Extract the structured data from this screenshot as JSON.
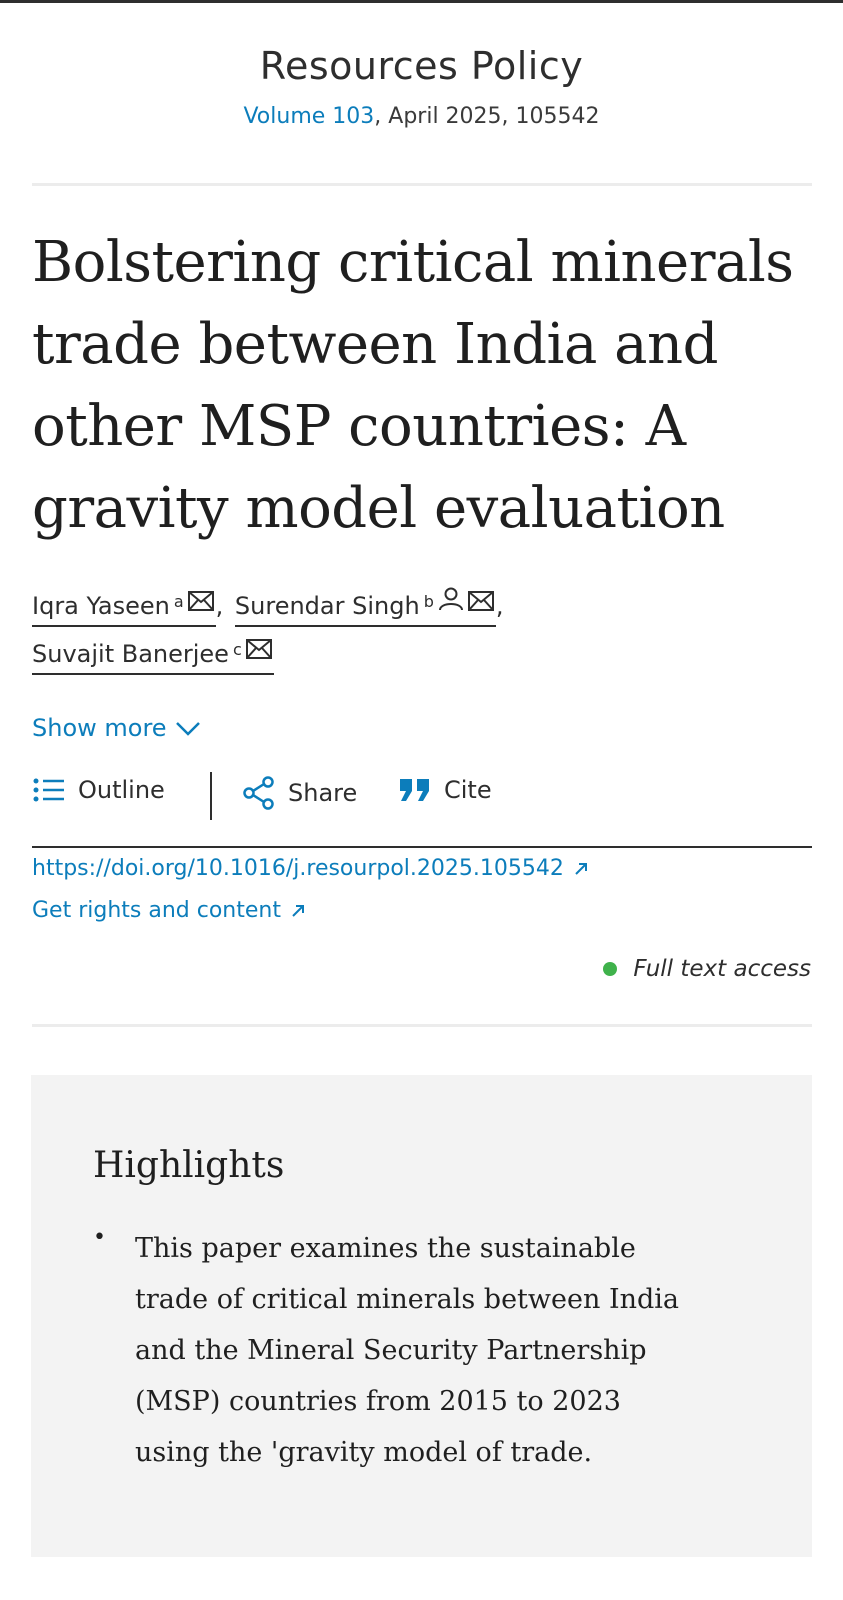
{
  "journal": {
    "name": "Resources Policy",
    "volume_link": "Volume 103",
    "issue_rest": ", April 2025, 105542"
  },
  "article": {
    "title": "Bolstering critical minerals trade between India and other MSP countries: A gravity model evaluation"
  },
  "authors": [
    {
      "name": "Iqra Yaseen",
      "sup": "a",
      "icons": [
        "envelope-icon"
      ]
    },
    {
      "name": "Surendar Singh",
      "sup": "b",
      "icons": [
        "person-icon",
        "envelope-icon"
      ]
    },
    {
      "name": "Suvajit Banerjee",
      "sup": "c",
      "icons": [
        "envelope-icon"
      ]
    }
  ],
  "separators": {
    "comma": ","
  },
  "show_more": {
    "label": "Show more"
  },
  "toolbar": {
    "outline_label": "Outline",
    "share_label": "Share",
    "cite_label": "Cite"
  },
  "links": {
    "doi": "https://doi.org/10.1016/j.resourpol.2025.105542",
    "rights": "Get rights and content"
  },
  "access": {
    "label": "Full text access",
    "dot_color": "#3fb24b"
  },
  "highlights": {
    "heading": "Highlights",
    "bullet": "•",
    "items": [
      "This paper examines the sustainable trade of critical minerals between India and the Mineral Security Partnership (MSP) countries from 2015 to 2023 using the 'gravity model of trade."
    ]
  },
  "colors": {
    "accent": "#0c7dbb",
    "text": "#1f1f1f",
    "panel": "#f3f3f3"
  }
}
